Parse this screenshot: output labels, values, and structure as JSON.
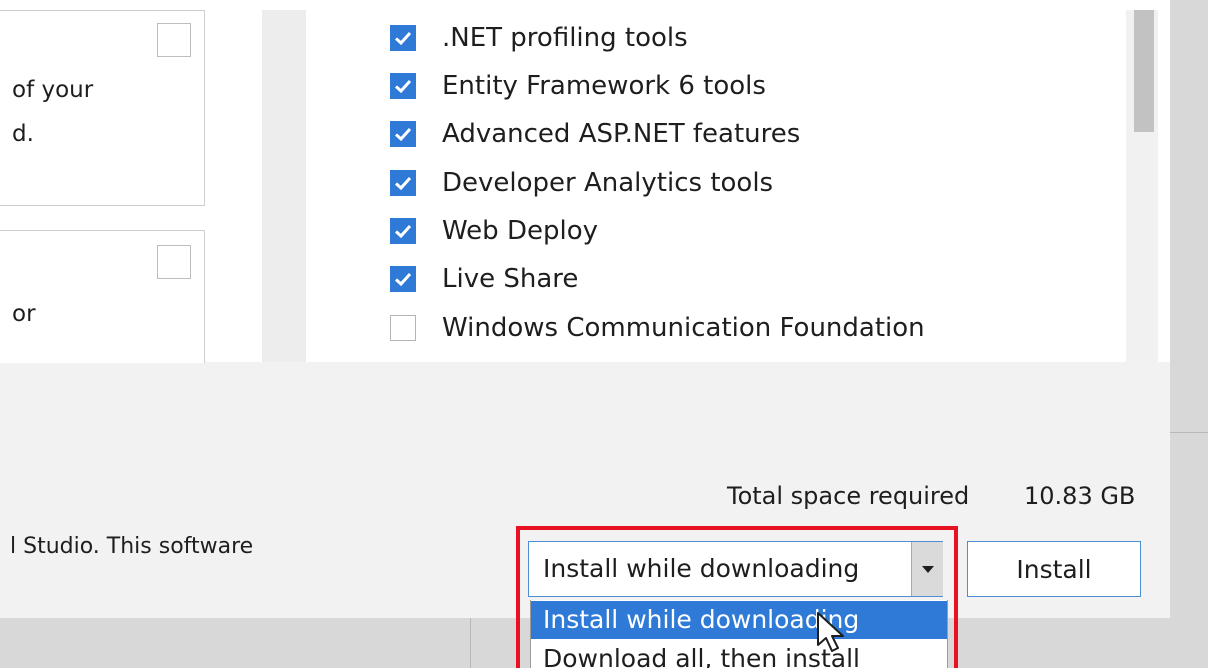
{
  "cards": [
    {
      "lines": [
        "of your",
        "d."
      ]
    },
    {
      "lines": [
        "or"
      ]
    }
  ],
  "components": [
    {
      "label": ".NET profiling tools",
      "checked": true
    },
    {
      "label": "Entity Framework 6 tools",
      "checked": true
    },
    {
      "label": "Advanced ASP.NET features",
      "checked": true
    },
    {
      "label": "Developer Analytics tools",
      "checked": true
    },
    {
      "label": "Web Deploy",
      "checked": true
    },
    {
      "label": "Live Share",
      "checked": true
    },
    {
      "label": "Windows Communication Foundation",
      "checked": false
    }
  ],
  "footer": {
    "license_text": "l Studio. This software",
    "space_label": "Total space required",
    "space_value": "10.83 GB",
    "install_mode": {
      "selected": "Install while downloading",
      "options": [
        "Install while downloading",
        "Download all, then install"
      ],
      "highlighted_option": "Install while downloading"
    },
    "install_button": "Install"
  },
  "colors": {
    "accent": "#2e7ad6",
    "highlight_box": "#e81123"
  },
  "icons": {
    "checkbox_checked": "checkmark-icon",
    "dropdown_arrow": "chevron-down-icon",
    "cursor": "mouse-pointer-icon"
  }
}
